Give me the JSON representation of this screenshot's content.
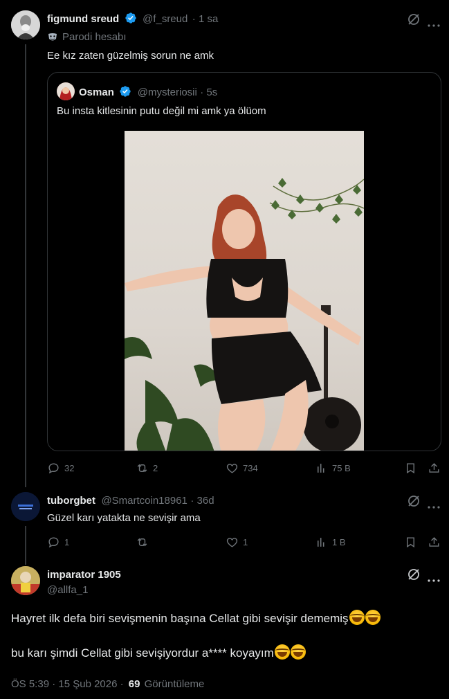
{
  "tweet1": {
    "name": "figmund sreud",
    "handle": "@f_sreud",
    "time": "· 1 sa",
    "badge": "Parodi hesabı",
    "text": "Ee kız zaten güzelmiş sorun ne amk",
    "quote": {
      "name": "Osman",
      "handle": "@mysteriosii",
      "time": "· 5s",
      "text": "Bu insta kitlesinin putu değil mi amk ya ölüom"
    },
    "actions": {
      "replies": "32",
      "reposts": "2",
      "likes": "734",
      "views": "75 B"
    }
  },
  "tweet2": {
    "name": "tuborgbet",
    "handle": "@Smartcoin18961",
    "time": "· 36d",
    "text": "Güzel karı yatakta ne sevişir ama",
    "actions": {
      "replies": "1",
      "reposts": "",
      "likes": "1",
      "views": "1 B"
    }
  },
  "main": {
    "name": "imparator 1905",
    "handle": "@allfa_1",
    "line1": "Hayret ilk defa biri sevişmenin başına Cellat gibi sevişir dememiş",
    "line2": "bu karı şimdi Cellat gibi sevişiyordur a**** koyayım",
    "timestamp": "ÖS 5:39 · 15 Şub 2026 ·",
    "views_count": "69",
    "views_label": "Görüntüleme"
  },
  "colors": {
    "accent": "#1d9bf0",
    "muted": "#71767b",
    "border": "#2f3336"
  }
}
